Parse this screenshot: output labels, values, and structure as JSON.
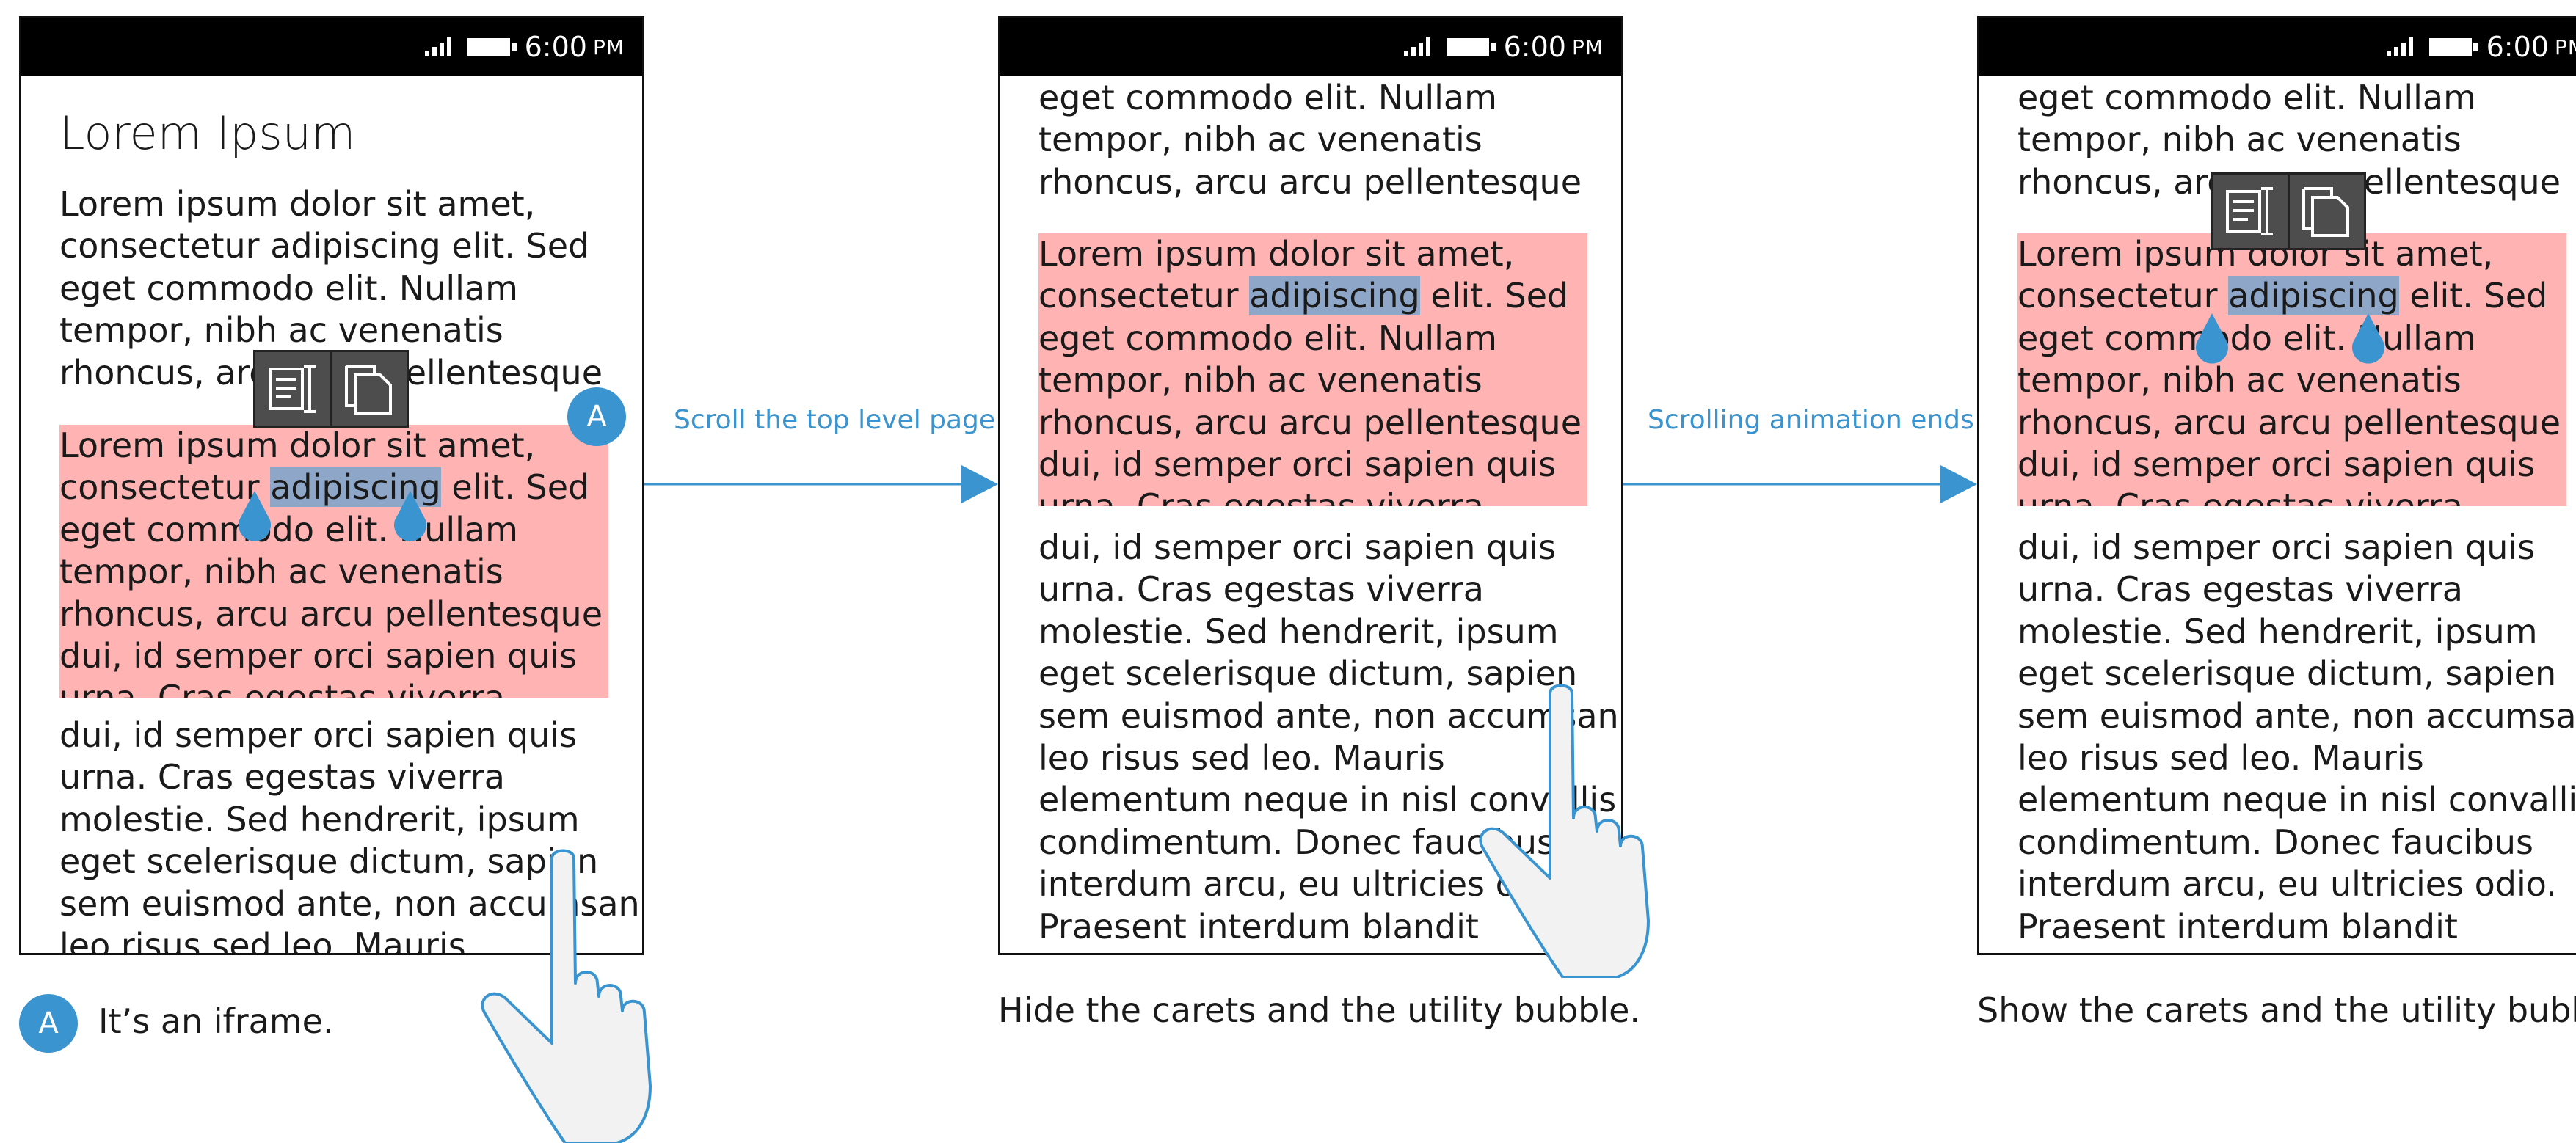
{
  "status_bar": {
    "time": "6:00",
    "ampm": "PM"
  },
  "phone1": {
    "heading": "Lorem Ipsum",
    "para1": [
      "Lorem ipsum dolor sit amet,",
      "consectetur adipiscing elit. Sed",
      "eget commodo elit. Nullam",
      "tempor, nibh ac venenatis",
      "rhoncus, arcu arcu pellentesque"
    ],
    "iframe_lines": [
      {
        "pre": "Lorem ipsum dolor sit amet,",
        "sel": "",
        "post": ""
      },
      {
        "pre": "consectetur ",
        "sel": "adipiscing",
        "post": " elit. Sed"
      },
      {
        "pre": "eget commodo elit. Nullam",
        "sel": "",
        "post": ""
      },
      {
        "pre": "tempor, nibh ac venenatis",
        "sel": "",
        "post": ""
      },
      {
        "pre": "rhoncus, arcu arcu pellentesque",
        "sel": "",
        "post": ""
      },
      {
        "pre": "dui, id semper orci sapien quis",
        "sel": "",
        "post": ""
      },
      {
        "pre": "urna. Cras egestas viverra",
        "sel": "",
        "post": ""
      }
    ],
    "para2": [
      "dui, id semper orci sapien quis",
      "urna. Cras egestas viverra",
      "molestie. Sed hendrerit, ipsum",
      "eget scelerisque dictum, sapien",
      "sem euismod ante, non accumsan",
      "leo risus sed leo. Mauris"
    ],
    "badge": "A"
  },
  "phone_scrolled": {
    "para1": [
      "eget commodo elit. Nullam",
      "tempor, nibh ac venenatis",
      "rhoncus, arcu arcu pellentesque"
    ],
    "iframe_lines": [
      {
        "pre": "Lorem ipsum dolor sit amet,",
        "sel": "",
        "post": ""
      },
      {
        "pre": "consectetur ",
        "sel": "adipiscing",
        "post": " elit. Sed"
      },
      {
        "pre": "eget commodo elit. Nullam",
        "sel": "",
        "post": ""
      },
      {
        "pre": "tempor, nibh ac venenatis",
        "sel": "",
        "post": ""
      },
      {
        "pre": "rhoncus, arcu arcu pellentesque",
        "sel": "",
        "post": ""
      },
      {
        "pre": "dui, id semper orci sapien quis",
        "sel": "",
        "post": ""
      },
      {
        "pre": "urna. Cras egestas viverra",
        "sel": "",
        "post": ""
      }
    ],
    "para2": [
      "dui, id semper orci sapien quis",
      "urna. Cras egestas viverra",
      "molestie. Sed hendrerit, ipsum",
      "eget scelerisque dictum, sapien",
      "sem euismod ante, non accumsan",
      "leo risus sed leo. Mauris",
      "elementum neque in nisl convallis",
      "condimentum. Donec faucibus",
      "interdum arcu, eu ultricies odio.",
      "Praesent interdum blandit"
    ]
  },
  "arrows": {
    "arrow1_label": "Scroll the top level page",
    "arrow2_label": "Scrolling animation ends"
  },
  "captions": {
    "legend_badge": "A",
    "legend_text": "It’s an iframe.",
    "phone2": "Hide the carets and the utility bubble.",
    "phone3": "Show the carets and the utility bubble."
  },
  "colors": {
    "accent": "#3a94cf",
    "iframe_bg": "#ffb3b3",
    "selection": "#8ea6c8",
    "bubble": "#4d4d4d"
  },
  "icons": [
    "signal-icon",
    "battery-icon",
    "select-all-icon",
    "copy-icon",
    "caret-handle-icon",
    "touch-hand-icon"
  ]
}
